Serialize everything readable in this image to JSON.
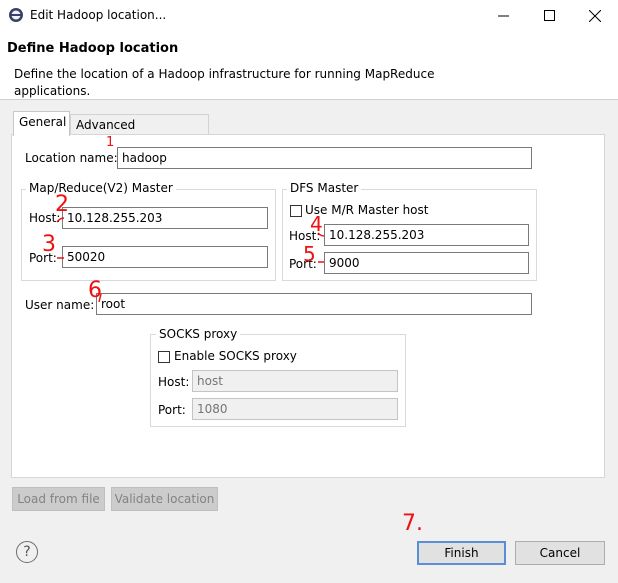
{
  "window": {
    "title": "Edit Hadoop location...",
    "minimize": "─",
    "maximize": "☐",
    "close": "✕"
  },
  "header": {
    "title": "Define Hadoop location",
    "description": "Define the location of a Hadoop infrastructure for running MapReduce applications."
  },
  "tabs": [
    {
      "label": "General"
    },
    {
      "label": "Advanced parameters"
    }
  ],
  "general": {
    "location_label": "Location name:",
    "location_value": "hadoop",
    "mr_master": {
      "title": "Map/Reduce(V2) Master",
      "host_label": "Host:",
      "host_value": "10.128.255.203",
      "port_label": "Port:",
      "port_value": "50020"
    },
    "dfs_master": {
      "title": "DFS Master",
      "use_mr_label": "Use M/R Master host",
      "host_label": "Host:",
      "host_value": "10.128.255.203",
      "port_label": "Port:",
      "port_value": "9000"
    },
    "user_label": "User name:",
    "user_value": "root",
    "socks": {
      "title": "SOCKS proxy",
      "enable_label": "Enable SOCKS proxy",
      "host_label": "Host:",
      "host_placeholder": "host",
      "port_label": "Port:",
      "port_placeholder": "1080"
    }
  },
  "annotations": [
    "1",
    "2",
    "3",
    "4",
    "5",
    "6",
    "7."
  ],
  "buttons": {
    "load": "Load from file",
    "validate": "Validate location",
    "finish": "Finish",
    "cancel": "Cancel",
    "help": "?"
  },
  "colors": {
    "annotation": "#e11111",
    "default_button_border": "#5a8ed6"
  }
}
